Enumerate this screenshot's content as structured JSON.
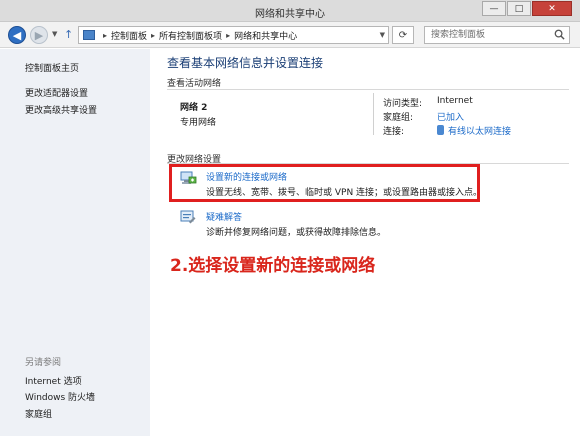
{
  "window": {
    "title": "网络和共享中心",
    "minimize": "—",
    "maximize": "□",
    "close": "✕"
  },
  "navbar": {
    "breadcrumbs": [
      "控制面板",
      "所有控制面板项",
      "网络和共享中心"
    ],
    "search_placeholder": "搜索控制面板"
  },
  "sidebar": {
    "items": [
      "控制面板主页",
      "更改适配器设置",
      "更改高级共享设置"
    ],
    "see_also_label": "另请参阅",
    "see_also_items": [
      "Internet 选项",
      "Windows 防火墙",
      "家庭组"
    ]
  },
  "main": {
    "title": "查看基本网络信息并设置连接",
    "active_networks_label": "查看活动网络",
    "network": {
      "name": "网络  2",
      "type": "专用网络",
      "access_type_label": "访问类型:",
      "access_type_value": "Internet",
      "homegroup_label": "家庭组:",
      "homegroup_value": "已加入",
      "connection_label": "连接:",
      "connection_value": "有线以太网连接"
    },
    "change_settings_label": "更改网络设置",
    "tasks": [
      {
        "link": "设置新的连接或网络",
        "description": "设置无线、宽带、拨号、临时或 VPN 连接；或设置路由器或接入点。"
      },
      {
        "link": "疑难解答",
        "description": "诊断并修复网络问题，或获得故障排除信息。"
      }
    ],
    "annotation": "2.选择设置新的连接或网络"
  },
  "colors": {
    "link": "#1b6ac9",
    "title": "#1a3e75",
    "highlight": "#e01f1f",
    "annotation": "#d9261c",
    "sidebar_bg": "#eef1f6"
  }
}
